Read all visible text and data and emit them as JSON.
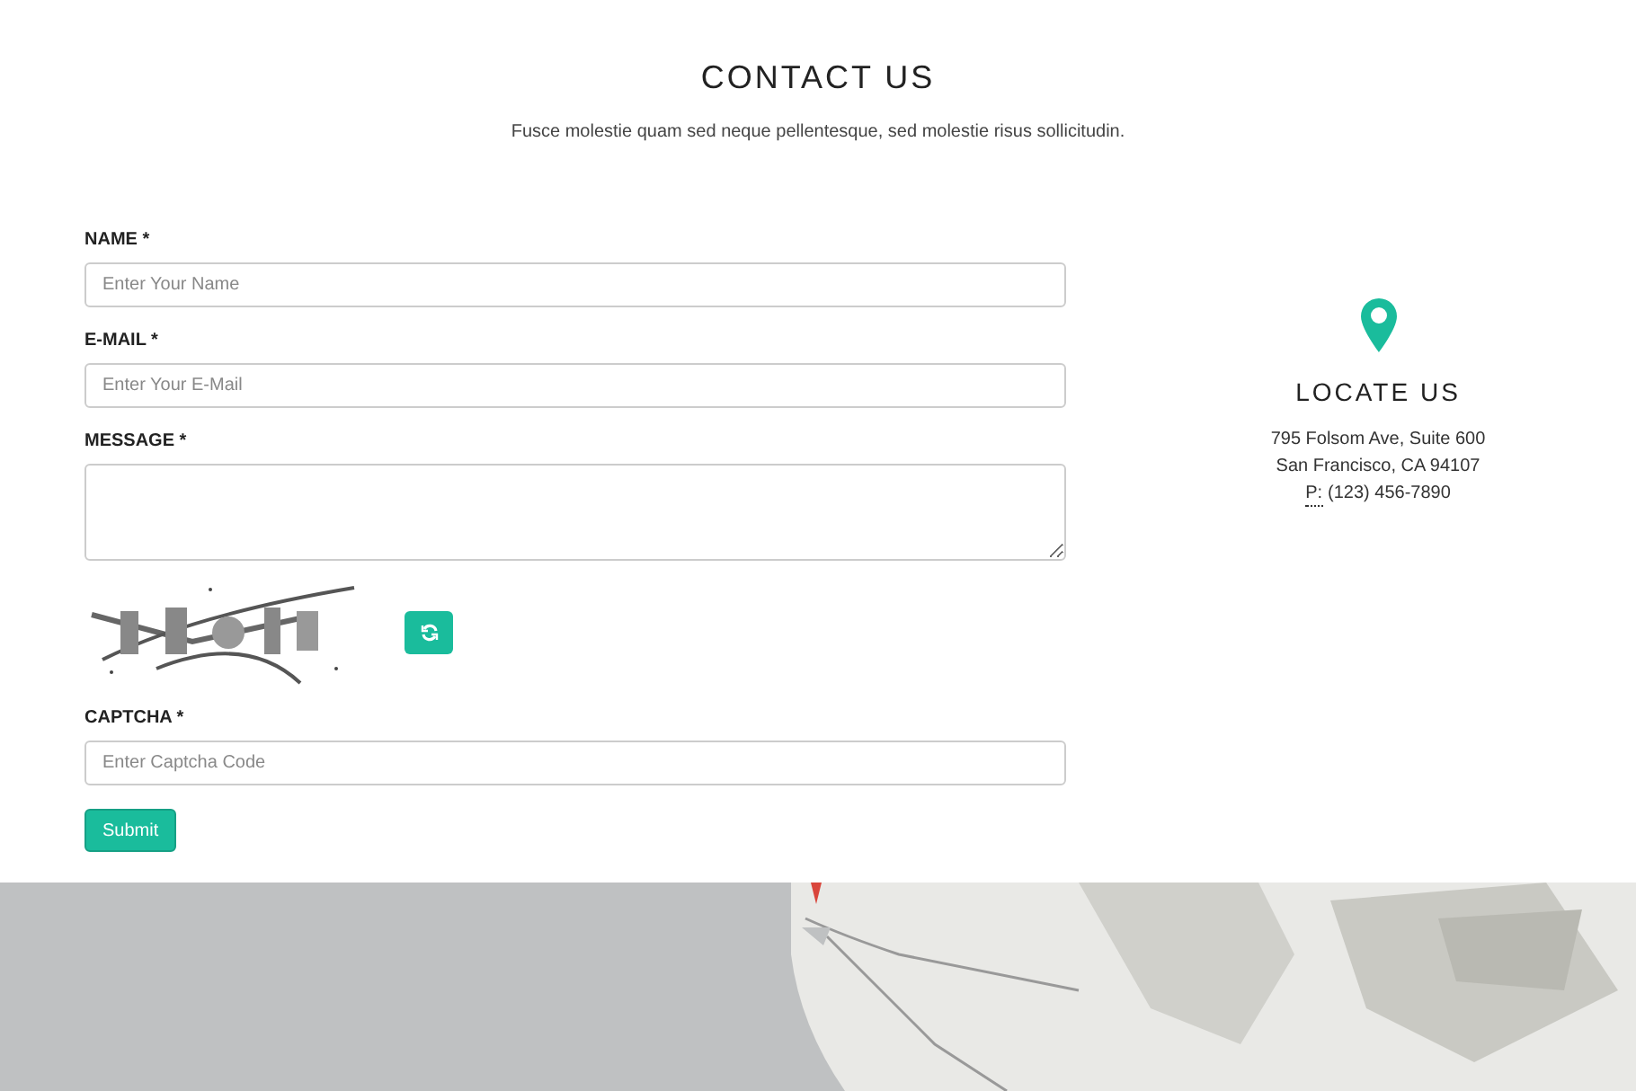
{
  "header": {
    "title": "CONTACT US",
    "subtitle": "Fusce molestie quam sed neque pellentesque, sed molestie risus sollicitudin."
  },
  "form": {
    "fields": [
      {
        "kind": "input",
        "label": "NAME *",
        "placeholder": "Enter Your Name"
      },
      {
        "kind": "input",
        "label": "E-MAIL *",
        "placeholder": "Enter Your E-Mail"
      },
      {
        "kind": "textarea",
        "label": "MESSAGE *"
      }
    ],
    "captcha": {
      "label": "CAPTCHA *",
      "placeholder": "Enter Captcha Code"
    },
    "submit": "Submit"
  },
  "locate": {
    "title": "LOCATE US",
    "address": [
      "795 Folsom Ave, Suite 600",
      "San Francisco, CA 94107"
    ],
    "phone_label": "P:",
    "phone": "(123) 456-7890"
  }
}
